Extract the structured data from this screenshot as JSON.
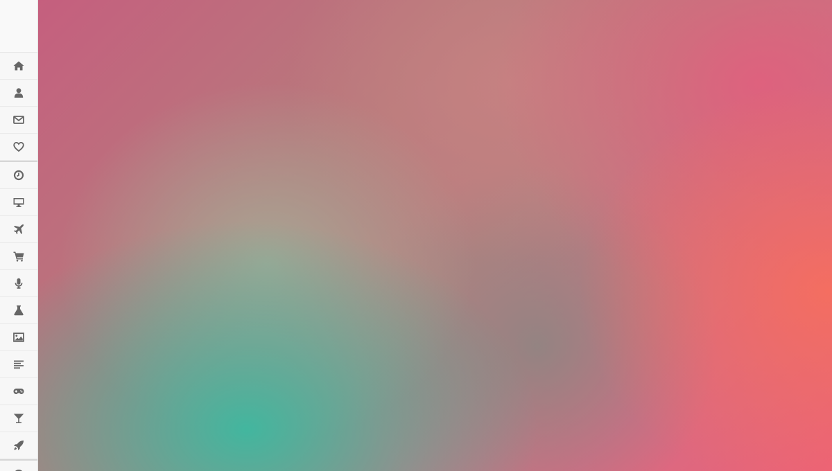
{
  "sidebar": {
    "items": [
      {
        "icon": "home-icon"
      },
      {
        "icon": "user-icon"
      },
      {
        "icon": "mail-icon"
      },
      {
        "icon": "heart-icon"
      },
      {
        "icon": "clock-icon"
      },
      {
        "icon": "desktop-icon"
      },
      {
        "icon": "plane-icon"
      },
      {
        "icon": "cart-icon"
      },
      {
        "icon": "microphone-icon"
      },
      {
        "icon": "flask-icon"
      },
      {
        "icon": "image-icon"
      },
      {
        "icon": "align-left-icon"
      },
      {
        "icon": "gamepad-icon"
      },
      {
        "icon": "cocktail-icon"
      },
      {
        "icon": "rocket-icon"
      },
      {
        "icon": "question-icon"
      }
    ]
  },
  "colors": {
    "sidebar_bg": "#f7f7f7",
    "icon": "#666666",
    "accent_teal": "#3cb9a0",
    "accent_pink": "#e15f7d",
    "accent_coral": "#f56e5f"
  }
}
